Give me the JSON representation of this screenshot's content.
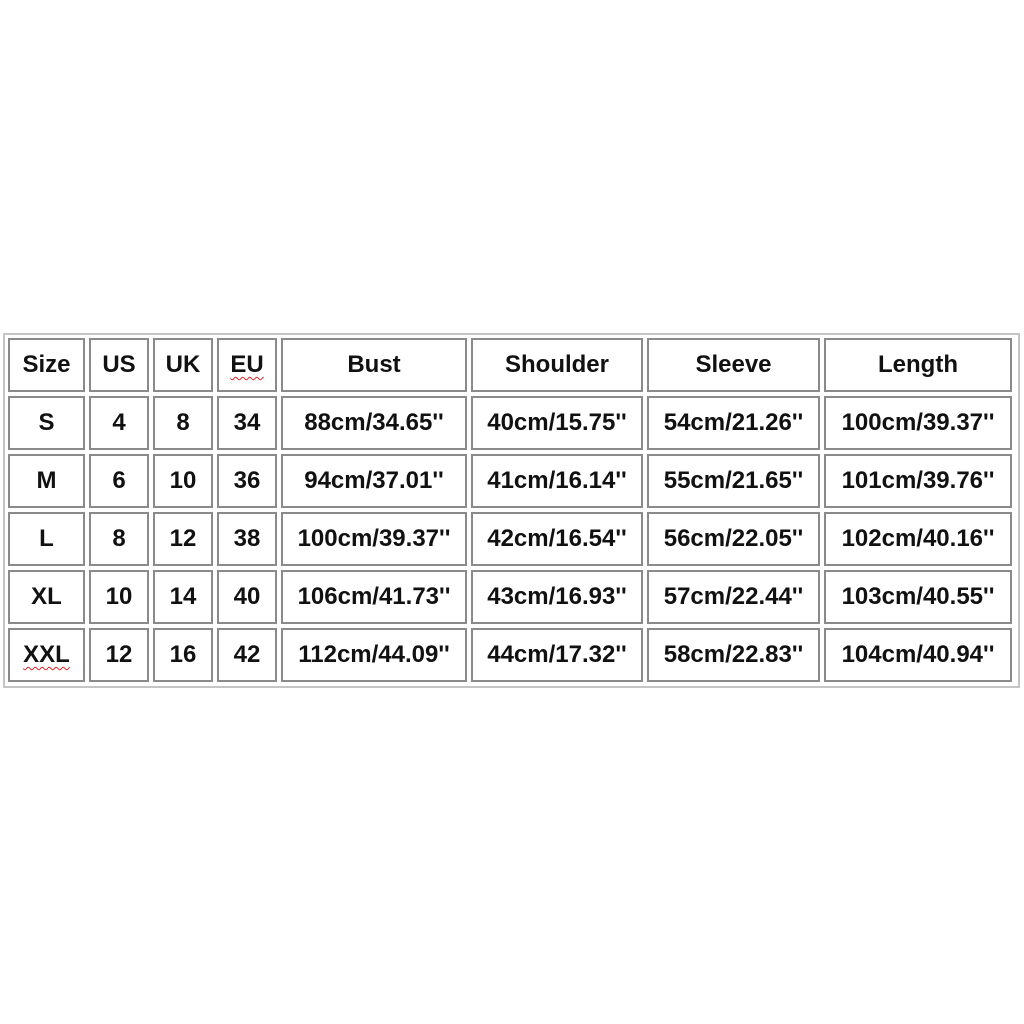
{
  "size_chart": {
    "headers": [
      "Size",
      "US",
      "UK",
      "EU",
      "Bust",
      "Shoulder",
      "Sleeve",
      "Length"
    ],
    "rows": [
      [
        "S",
        "4",
        "8",
        "34",
        "88cm/34.65''",
        "40cm/15.75''",
        "54cm/21.26''",
        "100cm/39.37''"
      ],
      [
        "M",
        "6",
        "10",
        "36",
        "94cm/37.01''",
        "41cm/16.14''",
        "55cm/21.65''",
        "101cm/39.76''"
      ],
      [
        "L",
        "8",
        "12",
        "38",
        "100cm/39.37''",
        "42cm/16.54''",
        "56cm/22.05''",
        "102cm/40.16''"
      ],
      [
        "XL",
        "10",
        "14",
        "40",
        "106cm/41.73''",
        "43cm/16.93''",
        "57cm/22.44''",
        "103cm/40.55''"
      ],
      [
        "XXL",
        "12",
        "16",
        "42",
        "112cm/44.09''",
        "44cm/17.32''",
        "58cm/22.83''",
        "104cm/40.94''"
      ]
    ]
  }
}
